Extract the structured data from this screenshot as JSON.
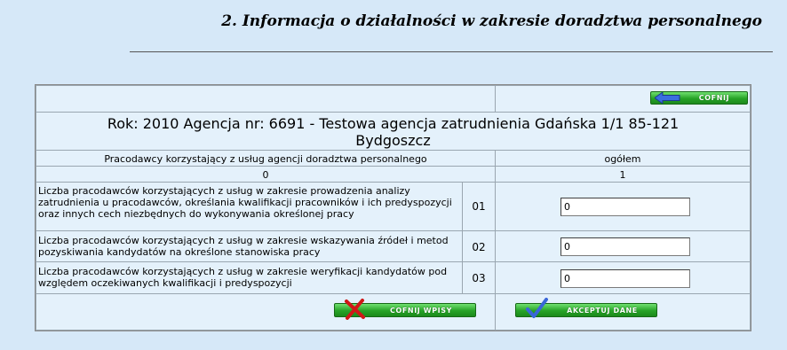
{
  "page": {
    "title": "2. Informacja o działalności w zakresie doradztwa personalnego"
  },
  "nav": {
    "back_label": "Cofnij"
  },
  "header": {
    "line1": "Rok: 2010     Agencja nr:  6691   -   Testowa agencja zatrudnienia      Gdańska 1/1 85-121",
    "line2": "Bydgoszcz"
  },
  "table": {
    "col_header_left": "Pracodawcy korzystający z usług agencji doradztwa personalnego",
    "col_header_right": "ogółem",
    "col_index_left": "0",
    "col_index_right": "1",
    "rows": [
      {
        "text": "Liczba pracodawców korzystających z usług w zakresie prowadzenia analizy zatrudnienia u pracodawców, określania kwalifikacji pracowników i ich predyspozycji oraz innych cech niezbędnych do wykonywania określonej pracy",
        "code": "01",
        "value": "0"
      },
      {
        "text": "Liczba pracodawców korzystających z usług w zakresie wskazywania źródeł i metod pozyskiwania kandydatów na określone stanowiska pracy",
        "code": "02",
        "value": "0"
      },
      {
        "text": "Liczba pracodawców korzystających z usług w zakresie weryfikacji kandydatów pod względem oczekiwanych kwalifikacji i predyspozycji",
        "code": "03",
        "value": "0"
      }
    ]
  },
  "actions": {
    "undo_label": "Cofnij wpisy",
    "accept_label": "Akceptuj dane"
  },
  "icons": {
    "back": "arrow-left-icon",
    "undo": "red-x-icon",
    "accept": "checkmark-icon"
  },
  "colors": {
    "background": "#d6e8f8",
    "button_green": "#27a327"
  }
}
